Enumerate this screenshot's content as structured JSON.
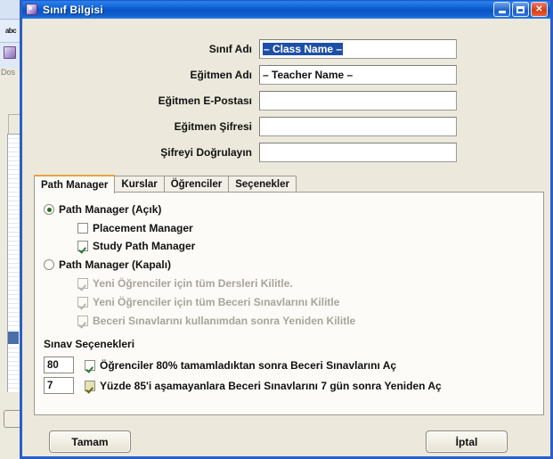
{
  "background_app": {
    "toolbar_label": "abc",
    "menu_label": "Dos",
    "app_icon": "cube-icon"
  },
  "window": {
    "title": "Sınıf Bilgisi",
    "icon": "cube-icon",
    "controls": {
      "minimize": "minimize-icon",
      "maximize": "maximize-icon",
      "close": "✕"
    }
  },
  "form": {
    "fields": [
      {
        "label": "Sınıf Adı",
        "value": "– Class Name –",
        "selected": true,
        "placeholder": ""
      },
      {
        "label": "Eğitmen Adı",
        "value": "– Teacher Name –",
        "selected": false,
        "placeholder": ""
      },
      {
        "label": "Eğitmen E-Postası",
        "value": "",
        "selected": false,
        "placeholder": ""
      },
      {
        "label": "Eğitmen Şifresi",
        "value": "",
        "selected": false,
        "placeholder": ""
      },
      {
        "label": "Şifreyi Doğrulayın",
        "value": "",
        "selected": false,
        "placeholder": ""
      }
    ]
  },
  "tabs": [
    {
      "label": "Path Manager",
      "active": true
    },
    {
      "label": "Kurslar",
      "active": false
    },
    {
      "label": "Öğrenciler",
      "active": false
    },
    {
      "label": "Seçenekler",
      "active": false
    }
  ],
  "path_manager": {
    "radio_open": {
      "label": "Path Manager (Açık)",
      "checked": true
    },
    "sub_open": [
      {
        "label": "Placement Manager",
        "checked": false
      },
      {
        "label": "Study Path Manager",
        "checked": true
      }
    ],
    "radio_closed": {
      "label": "Path Manager (Kapalı)",
      "checked": false
    },
    "sub_closed": [
      {
        "label": "Yeni Öğrenciler için tüm Dersleri Kilitle.",
        "checked": true
      },
      {
        "label": "Yeni Öğrenciler için tüm Beceri Sınavlarını Kilitle",
        "checked": true
      },
      {
        "label": "Beceri Sınavlarını kullanımdan sonra Yeniden Kilitle",
        "checked": true
      }
    ]
  },
  "exam_options": {
    "title": "Sınav Seçenekleri",
    "rows": [
      {
        "number": "80",
        "label": "Öğrenciler 80% tamamladıktan sonra Beceri Sınavlarını Aç",
        "checked": true,
        "highlight": false
      },
      {
        "number": "7",
        "label": "Yüzde 85'i aşamayanlara Beceri Sınavlarını 7 gün sonra Yeniden Aç",
        "checked": true,
        "highlight": true
      }
    ]
  },
  "buttons": {
    "ok": "Tamam",
    "cancel": "İptal"
  },
  "colors": {
    "titlebar_blue": "#1064d8",
    "dialog_face": "#ece8dc",
    "panel_face": "#fcfbf7",
    "selection_blue": "#1e4fa8",
    "active_tab_accent": "#e8a33d",
    "check_green": "#2c7a3c",
    "disabled_gray": "#a8a49a",
    "close_red": "#d23c18"
  }
}
